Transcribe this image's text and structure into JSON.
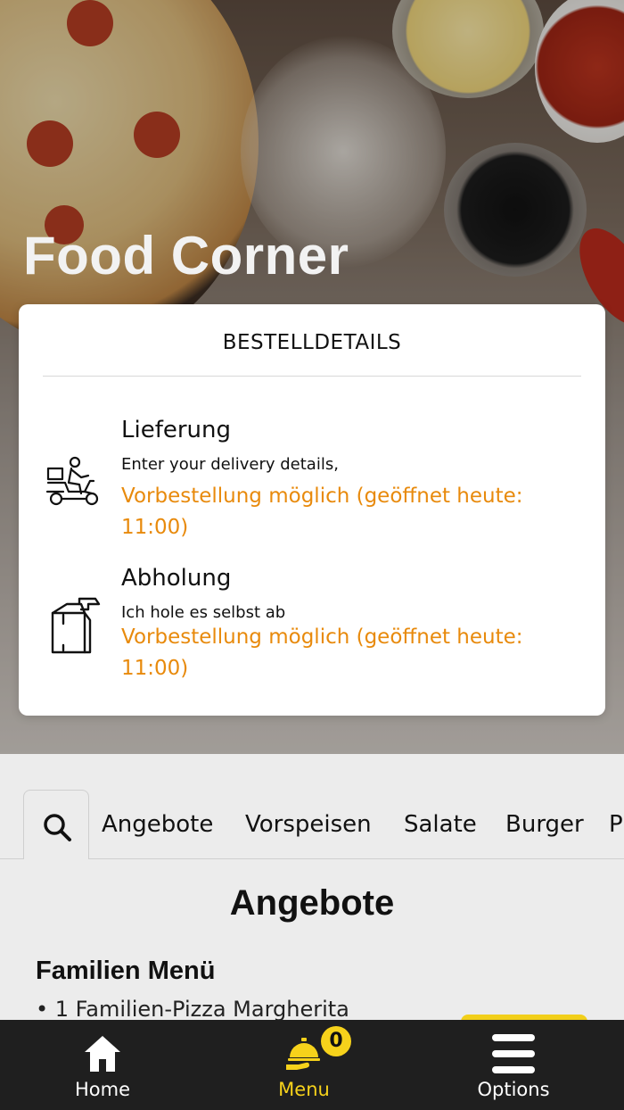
{
  "hero": {
    "brand_title": "Food Corner"
  },
  "order_card": {
    "title": "BESTELLDETAILS",
    "delivery": {
      "icon": "delivery-scooter-icon",
      "title": "Lieferung",
      "subtitle": "Enter your delivery details,",
      "note": "Vorbestellung möglich (geöffnet heute: 11:00)"
    },
    "pickup": {
      "icon": "takeaway-bag-icon",
      "title": "Abholung",
      "subtitle": "Ich hole es selbst ab",
      "note": "Vorbestellung möglich (geöffnet heute: 11:00)"
    }
  },
  "categories": {
    "search_icon": "search-icon",
    "items": [
      "Angebote",
      "Vorspeisen",
      "Salate",
      "Burger",
      "P"
    ]
  },
  "menu": {
    "section_title": "Angebote",
    "item_title": "Familien Menü",
    "item_line": "• 1 Familien-Pizza Margherita"
  },
  "bottom_nav": {
    "home_label": "Home",
    "menu_label": "Menu",
    "options_label": "Options",
    "cart_count": "0",
    "active": "Menu"
  },
  "colors": {
    "accent_orange": "#e88a0c",
    "accent_yellow": "#f6d21b",
    "nav_background": "#1f1f1f"
  }
}
